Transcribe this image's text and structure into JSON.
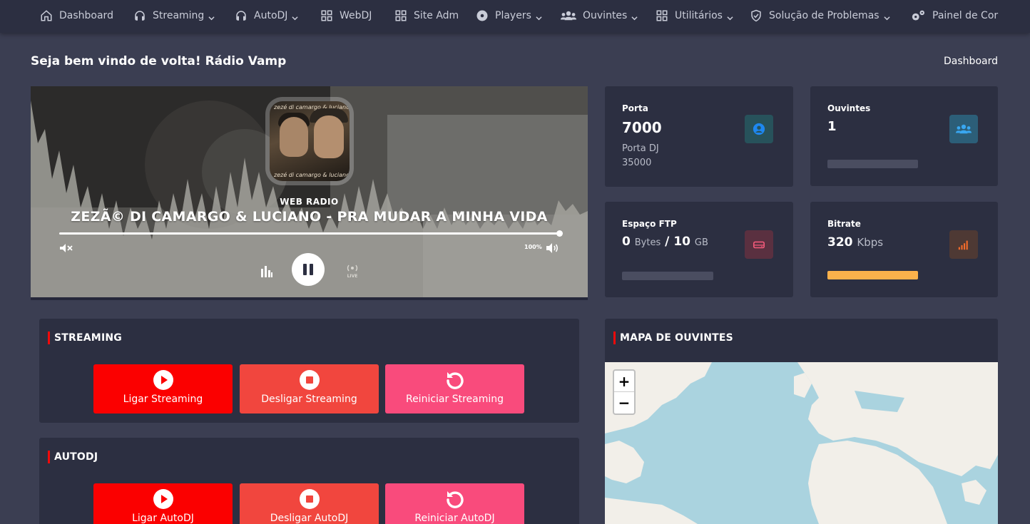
{
  "nav": {
    "items": [
      {
        "label": "Dashboard",
        "icon": "home-icon",
        "dropdown": false
      },
      {
        "label": "Streaming",
        "icon": "headphones-icon",
        "dropdown": true
      },
      {
        "label": "AutoDJ",
        "icon": "headphones-icon",
        "dropdown": true
      },
      {
        "label": "WebDJ",
        "icon": "grid-icon",
        "dropdown": false
      },
      {
        "label": "Site Adm",
        "icon": "grid-icon",
        "dropdown": false
      },
      {
        "label": "Players",
        "icon": "disc-icon",
        "dropdown": true
      },
      {
        "label": "Ouvintes",
        "icon": "users-icon",
        "dropdown": true
      },
      {
        "label": "Utilitários",
        "icon": "grid-icon",
        "dropdown": true
      },
      {
        "label": "Solução de Problemas",
        "icon": "shield-icon",
        "dropdown": true
      },
      {
        "label": "Painel de Cor",
        "icon": "gears-icon",
        "dropdown": false
      }
    ]
  },
  "header": {
    "welcome": "Seja bem vindo de volta! Rádio Vamp",
    "breadcrumb": "Dashboard"
  },
  "player": {
    "cover_text": "zezé di camargo & luciano",
    "station_label": "WEB RADIO",
    "song": "ZEZÃ© DI CAMARGO & LUCIANO - PRA MUDAR A MINHA VIDA",
    "volume": "100%",
    "state": "playing"
  },
  "cards": {
    "porta": {
      "label": "Porta",
      "value": "7000",
      "sub_label": "Porta DJ",
      "sub_value": "35000",
      "icon": "user-circle-icon",
      "icon_color": "#1e87f0",
      "icon_bg": "#27525b"
    },
    "ouvintes": {
      "label": "Ouvintes",
      "value": "1",
      "icon": "users-icon",
      "icon_color": "#39a7f1",
      "icon_bg": "#2c5e78",
      "bar_fraction": 0.0
    },
    "ftp": {
      "label": "Espaço FTP",
      "used": "0",
      "used_unit": "Bytes",
      "separator": "/",
      "total": "10",
      "total_unit": "GB",
      "icon": "hdd-icon",
      "icon_color": "#f15a7a",
      "icon_bg": "#5a3040",
      "bar_fraction": 0.0
    },
    "bitrate": {
      "label": "Bitrate",
      "value": "320",
      "unit": "Kbps",
      "icon": "signal-icon",
      "icon_color": "#f26b2a",
      "icon_bg": "#4e3934",
      "bar_fraction": 1.0,
      "bar_color": "#fbb14b"
    }
  },
  "streaming": {
    "title": "STREAMING",
    "buttons": [
      {
        "label": "Ligar Streaming",
        "icon": "play-circle-icon"
      },
      {
        "label": "Desligar Streaming",
        "icon": "stop-circle-icon"
      },
      {
        "label": "Reiniciar Streaming",
        "icon": "restart-icon"
      }
    ]
  },
  "autodj": {
    "title": "AUTODJ",
    "buttons": [
      {
        "label": "Ligar AutoDJ",
        "icon": "play-circle-icon"
      },
      {
        "label": "Desligar AutoDJ",
        "icon": "stop-circle-icon"
      },
      {
        "label": "Reiniciar AutoDJ",
        "icon": "restart-icon"
      }
    ]
  },
  "map": {
    "title": "MAPA DE OUVINTES",
    "zoom_in": "+",
    "zoom_out": "−"
  }
}
